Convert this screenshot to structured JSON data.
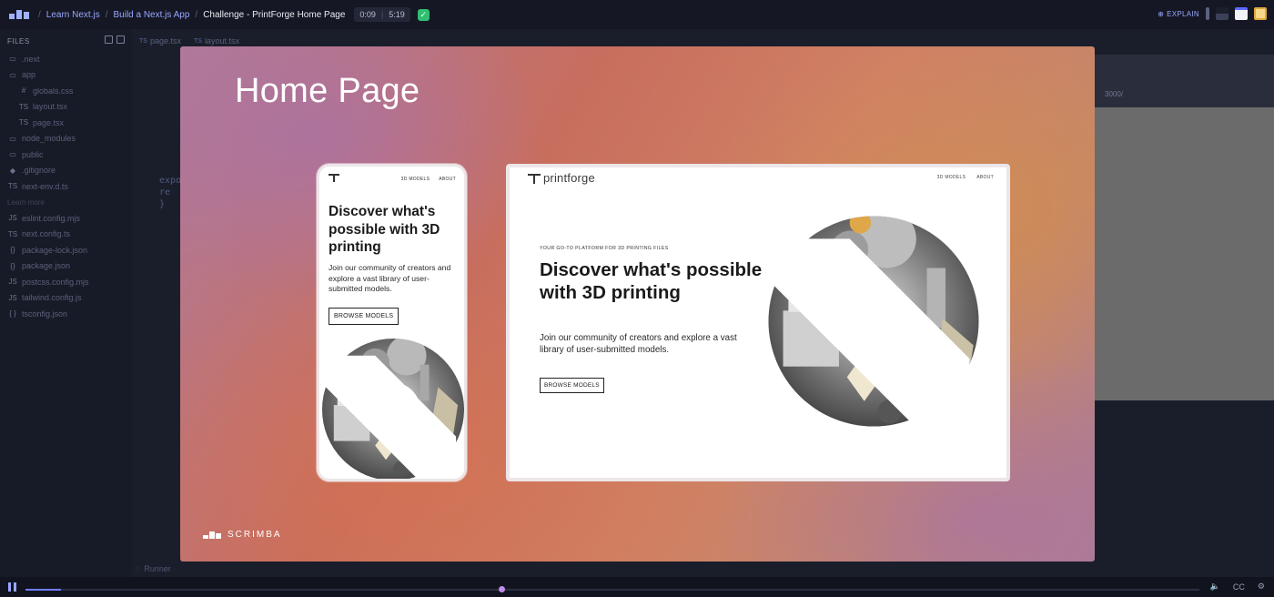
{
  "topbar": {
    "breadcrumbs": [
      "Learn Next.js",
      "Build a Next.js App",
      "Challenge - PrintForge Home Page"
    ],
    "time_current": "0:09",
    "time_total": "5:19",
    "explain_label": "EXPLAIN"
  },
  "sidebar": {
    "header": "FILES",
    "items": [
      {
        "icon": "folder-icon",
        "label": ".next",
        "level": 0
      },
      {
        "icon": "folder-icon",
        "label": "app",
        "level": 0
      },
      {
        "icon": "hash-icon",
        "label": "globals.css",
        "level": 1
      },
      {
        "icon": "ts-icon",
        "label": "layout.tsx",
        "level": 1
      },
      {
        "icon": "ts-icon",
        "label": "page.tsx",
        "level": 1
      },
      {
        "icon": "folder-icon",
        "label": "node_modules",
        "level": 0
      },
      {
        "icon": "folder-icon",
        "label": "public",
        "level": 0
      },
      {
        "icon": "git-icon",
        "label": ".gitignore",
        "level": 0
      },
      {
        "icon": "ts-icon",
        "label": "next-env.d.ts",
        "level": 0
      },
      {
        "icon": "",
        "label": "Learn more",
        "level": 0
      },
      {
        "icon": "js-icon",
        "label": "eslint.config.mjs",
        "level": 0
      },
      {
        "icon": "ts-icon",
        "label": "next.config.ts",
        "level": 0
      },
      {
        "icon": "json-icon",
        "label": "package-lock.json",
        "level": 0
      },
      {
        "icon": "json-icon",
        "label": "package.json",
        "level": 0
      },
      {
        "icon": "js-icon",
        "label": "postcss.config.mjs",
        "level": 0
      },
      {
        "icon": "js-icon",
        "label": "tailwind.config.js",
        "level": 0
      },
      {
        "icon": "braces-icon",
        "label": "tsconfig.json",
        "level": 0
      }
    ]
  },
  "editor": {
    "tabs": [
      "page.tsx",
      "layout.tsx"
    ],
    "code_lines": [
      "expo",
      "  re",
      "",
      "}",
      "",
      ""
    ],
    "preview_url": "3000/",
    "runner_label": "Runner"
  },
  "overlay": {
    "title": "Home Page",
    "brand": "SCRIMBA",
    "mobile": {
      "nav_links": [
        "3D MODELS",
        "ABOUT"
      ],
      "headline": "Discover what's possible with 3D printing",
      "body": "Join our community of creators and explore a vast library of user-submitted models.",
      "button": "BROWSE MODELS"
    },
    "desktop": {
      "logo_text": "printforge",
      "nav_links": [
        "3D MODELS",
        "ABOUT"
      ],
      "eyebrow": "YOUR GO-TO PLATFORM FOR 3D PRINTING FILES",
      "headline": "Discover what's possible with 3D printing",
      "body": "Join our community of creators and explore a vast library of user-submitted models.",
      "button": "BROWSE MODELS"
    }
  },
  "player": {
    "progress_fraction": 0.03,
    "cc_label": "CC"
  },
  "colors": {
    "accent": "#9aa6ff",
    "check_green": "#2fbf71",
    "marker_purple": "#c08be8"
  }
}
